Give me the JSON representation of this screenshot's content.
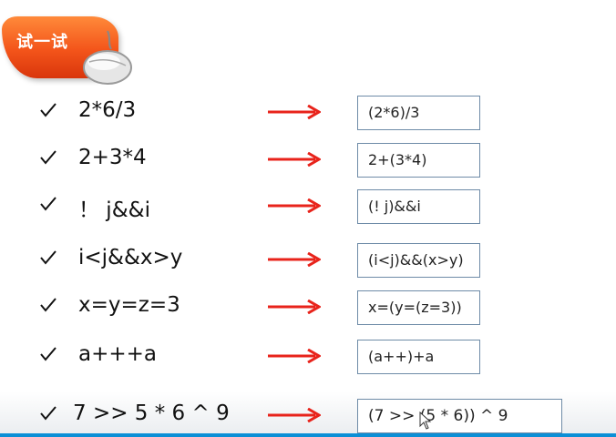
{
  "badge": {
    "label": "试一试"
  },
  "icons": {
    "badge": "mouse-icon",
    "item": "check-icon",
    "arrow": "arrow-icon",
    "cursor": "cursor-icon"
  },
  "colors": {
    "badge": "#f3541a",
    "arrow": "#e8231b",
    "box_border": "#6e8ba7",
    "bottom_line": "#0b8fd6"
  },
  "rows": [
    {
      "expression": "2*6/3",
      "result": "(2*6)/3"
    },
    {
      "expression": "2+3*4",
      "result": "2+(3*4)"
    },
    {
      "expression": "！ j&&i",
      "result": "(! j)&&i"
    },
    {
      "expression": "i<j&&x>y",
      "result": "(i<j)&&(x>y)"
    },
    {
      "expression": "x=y=z=3",
      "result": "x=(y=(z=3))"
    },
    {
      "expression": "a+++a",
      "result": "(a++)+a"
    },
    {
      "expression": "7 >> 5 * 6 ^ 9",
      "result": "(7 >> (5 * 6)) ^ 9"
    }
  ]
}
